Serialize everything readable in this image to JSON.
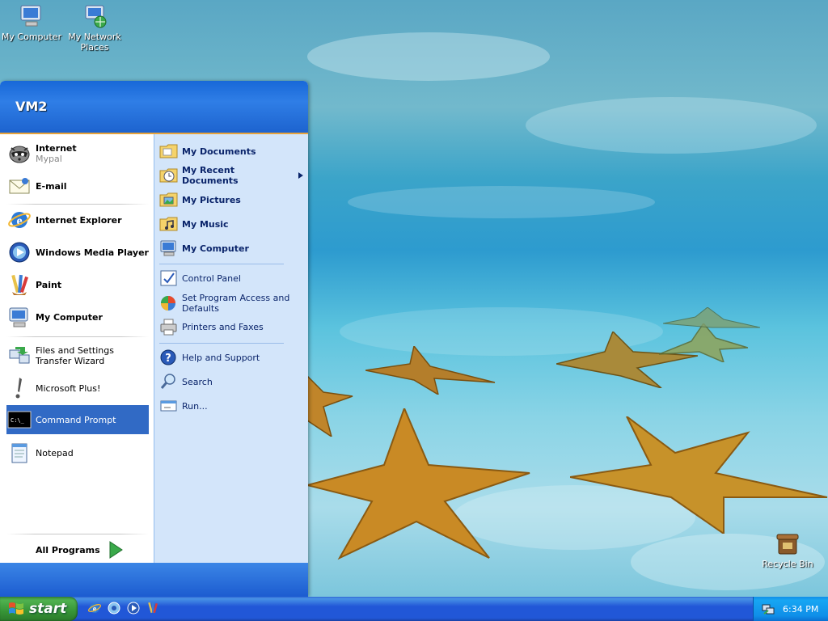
{
  "desktop": {
    "icons": [
      {
        "label": "My Computer",
        "icon": "computer-icon"
      },
      {
        "label": "My Network Places",
        "icon": "network-icon"
      },
      {
        "label": "Recycle Bin",
        "icon": "recycle-bin-icon"
      }
    ]
  },
  "start_menu": {
    "username": "VM2",
    "pinned": [
      {
        "label": "Internet",
        "sublabel": "Mypal",
        "icon": "raccoon-browser-icon"
      },
      {
        "label": "E-mail",
        "icon": "email-icon"
      }
    ],
    "recent": [
      {
        "label": "Internet Explorer",
        "icon": "internet-explorer-icon"
      },
      {
        "label": "Windows Media Player",
        "icon": "media-player-icon"
      },
      {
        "label": "Paint",
        "icon": "paint-icon"
      },
      {
        "label": "My Computer",
        "icon": "computer-icon"
      },
      {
        "label": "Files and Settings Transfer Wizard",
        "icon": "transfer-wizard-icon"
      },
      {
        "label": "Microsoft Plus!",
        "icon": "exclamation-icon"
      },
      {
        "label": "Command Prompt",
        "icon": "command-prompt-icon",
        "selected": true
      },
      {
        "label": "Notepad",
        "icon": "notepad-icon"
      }
    ],
    "all_programs": "All Programs",
    "right": [
      {
        "label": "My Documents",
        "icon": "folder-documents-icon"
      },
      {
        "label": "My Recent Documents",
        "icon": "recent-documents-icon",
        "submenu": true
      },
      {
        "label": "My Pictures",
        "icon": "folder-pictures-icon"
      },
      {
        "label": "My Music",
        "icon": "folder-music-icon"
      },
      {
        "label": "My Computer",
        "icon": "computer-icon"
      },
      {
        "label": "Control Panel",
        "icon": "control-panel-icon"
      },
      {
        "label": "Set Program Access and Defaults",
        "icon": "program-access-icon"
      },
      {
        "label": "Printers and Faxes",
        "icon": "printer-icon"
      },
      {
        "label": "Help and Support",
        "icon": "help-icon"
      },
      {
        "label": "Search",
        "icon": "search-icon"
      },
      {
        "label": "Run...",
        "icon": "run-icon"
      }
    ]
  },
  "taskbar": {
    "start_label": "start",
    "quick_launch": [
      "internet-explorer-icon",
      "browser-icon",
      "media-player-icon",
      "paint-icon"
    ],
    "clock": "6:34 PM",
    "tray_icon": "network-tray-icon"
  },
  "colors": {
    "taskbar_blue": "#2157d7",
    "start_green": "#379537",
    "selection_blue": "#316ac5",
    "right_pane": "#d3e5fa"
  }
}
